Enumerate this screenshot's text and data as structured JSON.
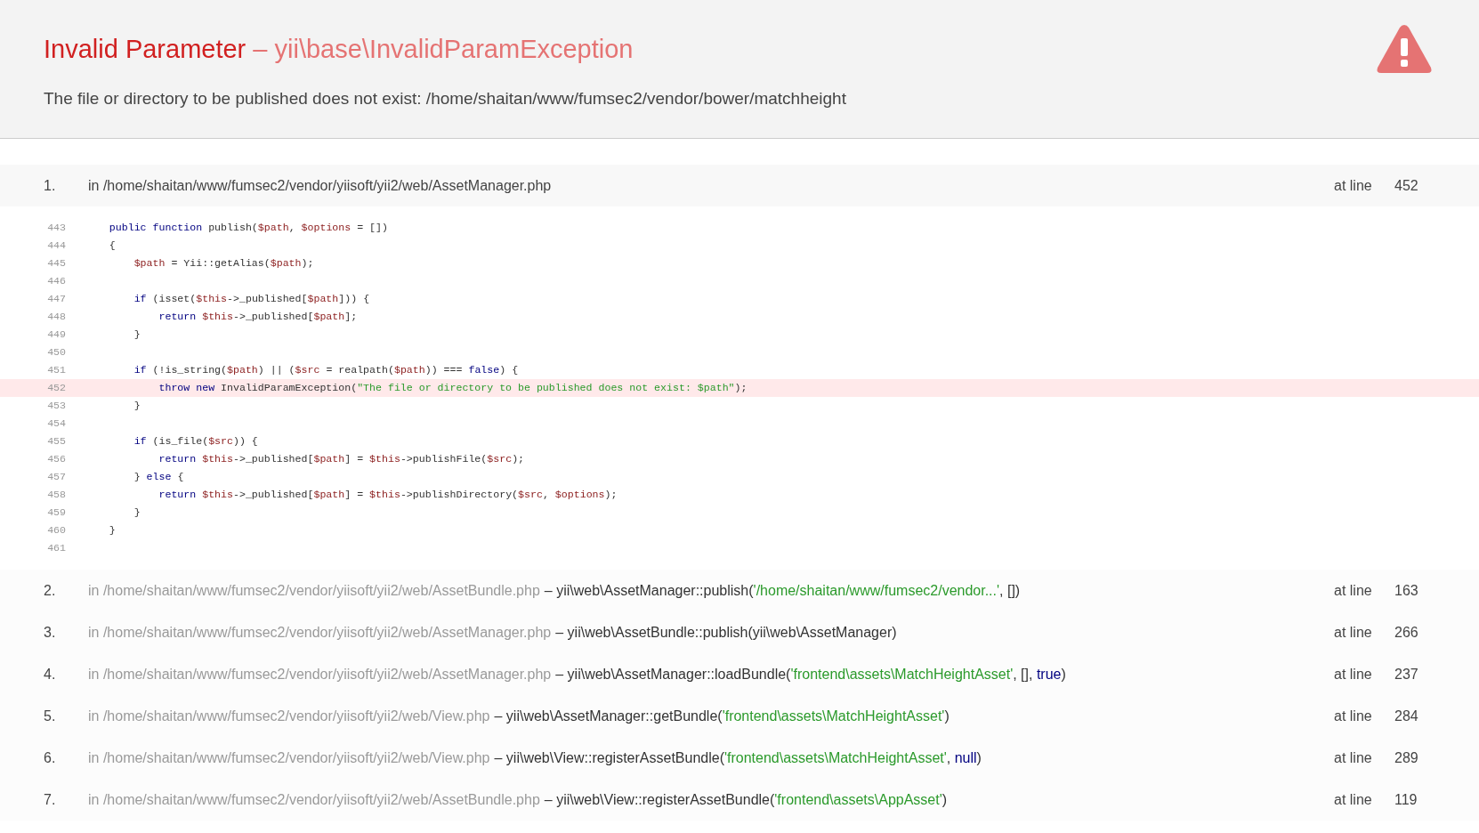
{
  "header": {
    "title": "Invalid Parameter",
    "separator": "–",
    "exception": "yii\\base\\InvalidParamException",
    "message": "The file or directory to be published does not exist: /home/shaitan/www/fumsec2/vendor/bower/matchheight"
  },
  "trace": [
    {
      "number": "1.",
      "file": "in /home/shaitan/www/fumsec2/vendor/yiisoft/yii2/web/AssetManager.php",
      "at_label": "at line",
      "line": "452",
      "expanded": true,
      "code": [
        {
          "number": "443",
          "highlighted": false,
          "tokens": [
            {
              "kind": "kw",
              "text": "    public function"
            },
            {
              "kind": "p",
              "text": " publish("
            },
            {
              "kind": "v",
              "text": "$path"
            },
            {
              "kind": "p",
              "text": ", "
            },
            {
              "kind": "v",
              "text": "$options"
            },
            {
              "kind": "p",
              "text": " = [])"
            }
          ]
        },
        {
          "number": "444",
          "highlighted": false,
          "tokens": [
            {
              "kind": "p",
              "text": "    {"
            }
          ]
        },
        {
          "number": "445",
          "highlighted": false,
          "tokens": [
            {
              "kind": "v",
              "text": "        $path"
            },
            {
              "kind": "p",
              "text": " = Yii::getAlias("
            },
            {
              "kind": "v",
              "text": "$path"
            },
            {
              "kind": "p",
              "text": ");"
            }
          ]
        },
        {
          "number": "446",
          "highlighted": false
        },
        {
          "number": "447",
          "highlighted": false,
          "tokens": [
            {
              "kind": "kw",
              "text": "        if"
            },
            {
              "kind": "p",
              "text": " (isset("
            },
            {
              "kind": "v",
              "text": "$this"
            },
            {
              "kind": "p",
              "text": "->_published["
            },
            {
              "kind": "v",
              "text": "$path"
            },
            {
              "kind": "p",
              "text": "])) {"
            }
          ]
        },
        {
          "number": "448",
          "highlighted": false,
          "tokens": [
            {
              "kind": "kw",
              "text": "            return"
            },
            {
              "kind": "v",
              "text": " $this"
            },
            {
              "kind": "p",
              "text": "->_published["
            },
            {
              "kind": "v",
              "text": "$path"
            },
            {
              "kind": "p",
              "text": "];"
            }
          ]
        },
        {
          "number": "449",
          "highlighted": false,
          "tokens": [
            {
              "kind": "p",
              "text": "        }"
            }
          ]
        },
        {
          "number": "450",
          "highlighted": false
        },
        {
          "number": "451",
          "highlighted": false,
          "tokens": [
            {
              "kind": "kw",
              "text": "        if"
            },
            {
              "kind": "p",
              "text": " (!is_string("
            },
            {
              "kind": "v",
              "text": "$path"
            },
            {
              "kind": "p",
              "text": ") || ("
            },
            {
              "kind": "v",
              "text": "$src"
            },
            {
              "kind": "p",
              "text": " = realpath("
            },
            {
              "kind": "v",
              "text": "$path"
            },
            {
              "kind": "p",
              "text": ")) === "
            },
            {
              "kind": "kw",
              "text": "false"
            },
            {
              "kind": "p",
              "text": ") {"
            }
          ]
        },
        {
          "number": "452",
          "highlighted": true,
          "tokens": [
            {
              "kind": "kw",
              "text": "            throw new"
            },
            {
              "kind": "p",
              "text": " InvalidParamException("
            },
            {
              "kind": "s",
              "text": "\"The file or directory to be published does not exist: $path\""
            },
            {
              "kind": "p",
              "text": ");"
            }
          ]
        },
        {
          "number": "453",
          "highlighted": false,
          "tokens": [
            {
              "kind": "p",
              "text": "        }"
            }
          ]
        },
        {
          "number": "454",
          "highlighted": false
        },
        {
          "number": "455",
          "highlighted": false,
          "tokens": [
            {
              "kind": "kw",
              "text": "        if"
            },
            {
              "kind": "p",
              "text": " (is_file("
            },
            {
              "kind": "v",
              "text": "$src"
            },
            {
              "kind": "p",
              "text": ")) {"
            }
          ]
        },
        {
          "number": "456",
          "highlighted": false,
          "tokens": [
            {
              "kind": "kw",
              "text": "            return"
            },
            {
              "kind": "v",
              "text": " $this"
            },
            {
              "kind": "p",
              "text": "->_published["
            },
            {
              "kind": "v",
              "text": "$path"
            },
            {
              "kind": "p",
              "text": "] = "
            },
            {
              "kind": "v",
              "text": "$this"
            },
            {
              "kind": "p",
              "text": "->publishFile("
            },
            {
              "kind": "v",
              "text": "$src"
            },
            {
              "kind": "p",
              "text": ");"
            }
          ]
        },
        {
          "number": "457",
          "highlighted": false,
          "tokens": [
            {
              "kind": "p",
              "text": "        } "
            },
            {
              "kind": "kw",
              "text": "else"
            },
            {
              "kind": "p",
              "text": " {"
            }
          ]
        },
        {
          "number": "458",
          "highlighted": false,
          "tokens": [
            {
              "kind": "kw",
              "text": "            return"
            },
            {
              "kind": "v",
              "text": " $this"
            },
            {
              "kind": "p",
              "text": "->_published["
            },
            {
              "kind": "v",
              "text": "$path"
            },
            {
              "kind": "p",
              "text": "] = "
            },
            {
              "kind": "v",
              "text": "$this"
            },
            {
              "kind": "p",
              "text": "->publishDirectory("
            },
            {
              "kind": "v",
              "text": "$src"
            },
            {
              "kind": "p",
              "text": ", "
            },
            {
              "kind": "v",
              "text": "$options"
            },
            {
              "kind": "p",
              "text": ");"
            }
          ]
        },
        {
          "number": "459",
          "highlighted": false,
          "tokens": [
            {
              "kind": "p",
              "text": "        }"
            }
          ]
        },
        {
          "number": "460",
          "highlighted": false,
          "tokens": [
            {
              "kind": "p",
              "text": "    }"
            }
          ]
        },
        {
          "number": "461",
          "highlighted": false
        }
      ]
    },
    {
      "number": "2.",
      "file": "in /home/shaitan/www/fumsec2/vendor/yiisoft/yii2/web/AssetBundle.php",
      "call": [
        {
          "kind": "p",
          "text": "– yii\\web\\AssetManager::publish("
        },
        {
          "kind": "s",
          "text": "'/home/shaitan/www/fumsec2/vendor...'"
        },
        {
          "kind": "p",
          "text": ", [])"
        }
      ],
      "at_label": "at line",
      "line": "163",
      "expanded": false
    },
    {
      "number": "3.",
      "file": "in /home/shaitan/www/fumsec2/vendor/yiisoft/yii2/web/AssetManager.php",
      "call": [
        {
          "kind": "p",
          "text": "– yii\\web\\AssetBundle::publish(yii\\web\\AssetManager)"
        }
      ],
      "at_label": "at line",
      "line": "266",
      "expanded": false
    },
    {
      "number": "4.",
      "file": "in /home/shaitan/www/fumsec2/vendor/yiisoft/yii2/web/AssetManager.php",
      "call": [
        {
          "kind": "p",
          "text": "– yii\\web\\AssetManager::loadBundle("
        },
        {
          "kind": "s",
          "text": "'frontend\\assets\\MatchHeightAsset'"
        },
        {
          "kind": "p",
          "text": ", [], "
        },
        {
          "kind": "c",
          "text": "true"
        },
        {
          "kind": "p",
          "text": ")"
        }
      ],
      "at_label": "at line",
      "line": "237",
      "expanded": false
    },
    {
      "number": "5.",
      "file": "in /home/shaitan/www/fumsec2/vendor/yiisoft/yii2/web/View.php",
      "call": [
        {
          "kind": "p",
          "text": "– yii\\web\\AssetManager::getBundle("
        },
        {
          "kind": "s",
          "text": "'frontend\\assets\\MatchHeightAsset'"
        },
        {
          "kind": "p",
          "text": ")"
        }
      ],
      "at_label": "at line",
      "line": "284",
      "expanded": false
    },
    {
      "number": "6.",
      "file": "in /home/shaitan/www/fumsec2/vendor/yiisoft/yii2/web/View.php",
      "call": [
        {
          "kind": "p",
          "text": "– yii\\web\\View::registerAssetBundle("
        },
        {
          "kind": "s",
          "text": "'frontend\\assets\\MatchHeightAsset'"
        },
        {
          "kind": "p",
          "text": ", "
        },
        {
          "kind": "c",
          "text": "null"
        },
        {
          "kind": "p",
          "text": ")"
        }
      ],
      "at_label": "at line",
      "line": "289",
      "expanded": false
    },
    {
      "number": "7.",
      "file": "in /home/shaitan/www/fumsec2/vendor/yiisoft/yii2/web/AssetBundle.php",
      "call": [
        {
          "kind": "p",
          "text": "– yii\\web\\View::registerAssetBundle("
        },
        {
          "kind": "s",
          "text": "'frontend\\assets\\AppAsset'"
        },
        {
          "kind": "p",
          "text": ")"
        }
      ],
      "at_label": "at line",
      "line": "119",
      "expanded": false
    }
  ]
}
